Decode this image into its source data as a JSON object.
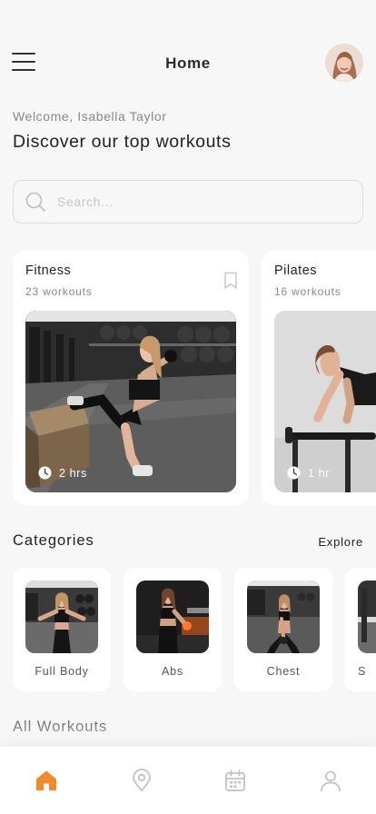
{
  "header": {
    "title": "Home",
    "menu_icon": "hamburger-menu-icon",
    "avatar_icon": "user-avatar"
  },
  "greeting": {
    "welcome": "Welcome, Isabella Taylor",
    "headline": "Discover our top workouts"
  },
  "search": {
    "placeholder": "Search...",
    "value": "",
    "icon": "search-icon"
  },
  "featured": [
    {
      "title": "Fitness",
      "subtitle": "23 workouts",
      "duration": "2 hrs",
      "bookmark": true
    },
    {
      "title": "Pilates",
      "subtitle": "16 workouts",
      "duration": "1 hr",
      "bookmark": false
    }
  ],
  "categories": {
    "title": "Categories",
    "explore_label": "Explore",
    "items": [
      {
        "label": "Full Body"
      },
      {
        "label": "Abs"
      },
      {
        "label": "Chest"
      },
      {
        "label": "S"
      }
    ]
  },
  "all_workouts": {
    "title": "All Workouts"
  },
  "bottom_nav": {
    "items": [
      {
        "icon": "home-icon",
        "active": true
      },
      {
        "icon": "location-icon",
        "active": false
      },
      {
        "icon": "calendar-icon",
        "active": false
      },
      {
        "icon": "profile-icon",
        "active": false
      }
    ]
  },
  "colors": {
    "accent": "#f08a2c",
    "background": "#f7f7f7",
    "card": "#ffffff",
    "text_primary": "#222222",
    "text_secondary": "#888888",
    "nav_inactive": "#c2c2c2"
  }
}
